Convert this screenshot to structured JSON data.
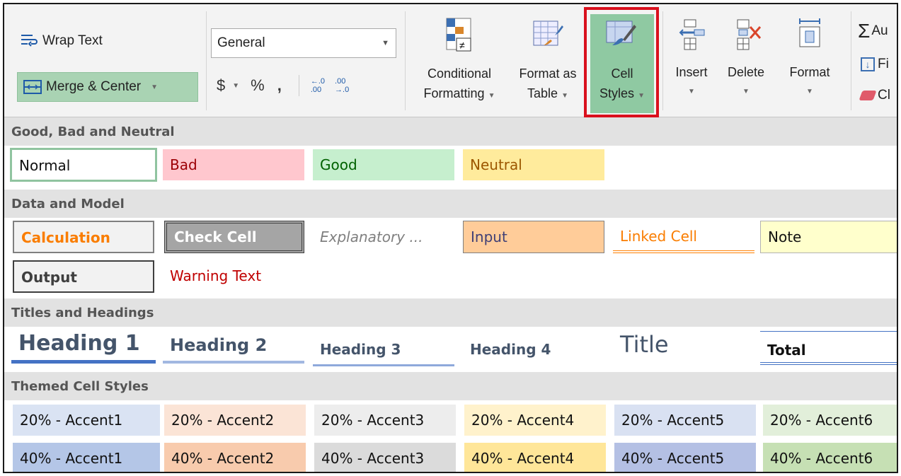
{
  "ribbon": {
    "wrap_text": "Wrap Text",
    "merge_center": "Merge & Center",
    "number_format": "General",
    "currency": "$",
    "percent": "%",
    "comma": ",",
    "increase_decimal_top": "←.0",
    "increase_decimal_bottom": ".00",
    "decrease_decimal_top": ".00",
    "decrease_decimal_bottom": "→.0",
    "conditional_formatting": [
      "Conditional",
      "Formatting"
    ],
    "format_as_table": [
      "Format as",
      "Table"
    ],
    "cell_styles": [
      "Cell",
      "Styles"
    ],
    "insert": "Insert",
    "delete": "Delete",
    "format": "Format",
    "autosum_partial": "Au",
    "fill_partial": "Fi",
    "clear_partial": "Cl",
    "highlight_color": "#d9101d"
  },
  "gallery": {
    "sections": [
      {
        "title": "Good, Bad and Neutral"
      },
      {
        "title": "Data and Model"
      },
      {
        "title": "Titles and Headings"
      },
      {
        "title": "Themed Cell Styles"
      }
    ],
    "good_bad_neutral": [
      "Normal",
      "Bad",
      "Good",
      "Neutral"
    ],
    "data_model": [
      "Calculation",
      "Check Cell",
      "Explanatory ...",
      "Input",
      "Linked Cell",
      "Note",
      "Output",
      "Warning Text"
    ],
    "titles": [
      "Heading 1",
      "Heading 2",
      "Heading 3",
      "Heading 4",
      "Title",
      "Total"
    ],
    "accent20": [
      "20% - Accent1",
      "20% - Accent2",
      "20% - Accent3",
      "20% - Accent4",
      "20% - Accent5",
      "20% - Accent6"
    ],
    "accent40": [
      "40% - Accent1",
      "40% - Accent2",
      "40% - Accent3",
      "40% - Accent4",
      "40% - Accent5",
      "40% - Accent6"
    ]
  }
}
